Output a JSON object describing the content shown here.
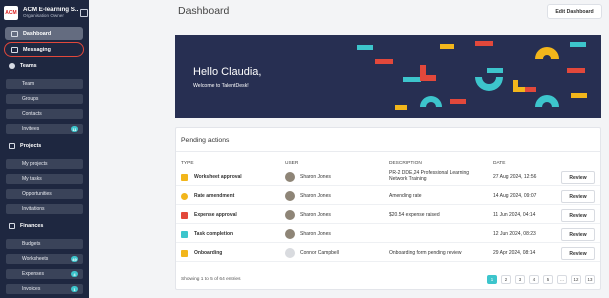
{
  "org": {
    "name": "ACM E-learning S...",
    "role": "Organisation Owner",
    "logo_text": "ACM"
  },
  "sidebar": {
    "primary": [
      {
        "label": "Dashboard",
        "icon": "dashboard-icon",
        "active": true
      },
      {
        "label": "Messaging",
        "icon": "message-icon",
        "highlighted": true
      }
    ],
    "teams": {
      "label": "Teams",
      "items": [
        "Team",
        "Groups",
        "Contacts",
        "Invitees"
      ],
      "invitees_badge": "11"
    },
    "projects": {
      "label": "Projects",
      "items": [
        "My projects",
        "My tasks",
        "Opportunities",
        "Invitations"
      ]
    },
    "finances": {
      "label": "Finances",
      "items": [
        "Budgets",
        "Worksheets",
        "Expenses",
        "Invoices"
      ],
      "badges": {
        "worksheets": "49",
        "expenses": "4",
        "invoices": "1"
      }
    }
  },
  "header": {
    "title": "Dashboard",
    "edit_button": "Edit Dashboard"
  },
  "banner": {
    "greeting": "Hello Claudia,",
    "subtitle": "Welcome to TalentDesk!",
    "bg_color": "#272f52",
    "accent_colors": [
      "#3dc5cc",
      "#e2483b",
      "#f2b61b"
    ]
  },
  "pending": {
    "title": "Pending actions",
    "columns": [
      "TYPE",
      "USER",
      "DESCRIPTION",
      "DATE"
    ],
    "rows": [
      {
        "type": "Worksheet approval",
        "icon": "worksheet-icon",
        "user": "Sharon Jones",
        "description": "PR-2 DDE,24 Professional Learning Network Training",
        "date": "27 Aug 2024, 12:56",
        "action": "Review"
      },
      {
        "type": "Rate amendment",
        "icon": "rate-icon",
        "user": "Sharon Jones",
        "description": "Amending rate",
        "date": "14 Aug 2024, 09:07",
        "action": "Review"
      },
      {
        "type": "Expense approval",
        "icon": "expense-icon",
        "user": "Sharon Jones",
        "description": "$20.54 expense raised",
        "date": "11 Jun 2024, 04:14",
        "action": "Review"
      },
      {
        "type": "Task completion",
        "icon": "task-icon",
        "user": "Sharon Jones",
        "description": "",
        "date": "12 Jun 2024, 08:23",
        "action": "Review"
      },
      {
        "type": "Onboarding",
        "icon": "onboarding-icon",
        "user": "Connor Campbell",
        "description": "Onboarding form pending review",
        "date": "29 Apr 2024, 08:14",
        "action": "Review"
      }
    ],
    "footer": "Showing 1 to 5 of 64 entries",
    "pages": [
      "1",
      "2",
      "3",
      "4",
      "5",
      "...",
      "12",
      "13"
    ],
    "current_page": "1"
  }
}
